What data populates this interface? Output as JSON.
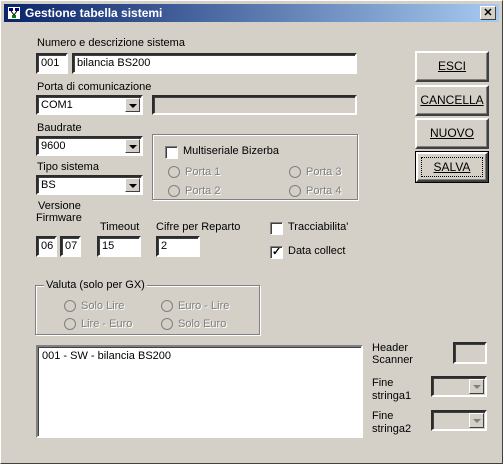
{
  "window": {
    "title": "Gestione tabella sistemi",
    "close_symbol": "✕"
  },
  "sistema": {
    "label": "Numero e descrizione sistema",
    "number": "001",
    "description": "bilancia BS200"
  },
  "porta": {
    "label": "Porta di comunicazione",
    "value": "COM1",
    "extra": ""
  },
  "baudrate": {
    "label": "Baudrate",
    "value": "9600"
  },
  "tipo": {
    "label": "Tipo sistema",
    "value": "BS"
  },
  "multiseriale": {
    "label": "Multiseriale Bizerba",
    "porta1": "Porta 1",
    "porta2": "Porta 2",
    "porta3": "Porta 3",
    "porta4": "Porta 4"
  },
  "versione": {
    "label_line1": "Versione",
    "label_line2": "Firmware",
    "major": "06",
    "minor": "07"
  },
  "timeout": {
    "label": "Timeout",
    "value": "15"
  },
  "cifre": {
    "label": "Cifre per Reparto",
    "value": "2"
  },
  "tracciabilita": {
    "label": "Tracciabilita'",
    "checked": false
  },
  "datacollect": {
    "label": "Data collect",
    "checked": true
  },
  "valuta": {
    "title": "Valuta (solo per GX)",
    "solo_lire": "Solo Lire",
    "euro_lire": "Euro - Lire",
    "lire_euro": "Lire - Euro",
    "solo_euro": "Solo Euro"
  },
  "list": {
    "items": [
      "001 - SW - bilancia BS200"
    ]
  },
  "scanner": {
    "header_label1": "Header",
    "header_label2": "Scanner",
    "header_value": "",
    "fine1_label1": "Fine",
    "fine1_label2": "stringa1",
    "fine1_value": "",
    "fine2_label1": "Fine",
    "fine2_label2": "stringa2",
    "fine2_value": ""
  },
  "buttons": {
    "esci": "ESCI",
    "cancella": "CANCELLA",
    "nuovo": "NUOVO",
    "salva": "SALVA"
  },
  "icons": {
    "app": "network-icon",
    "close": "close-icon"
  }
}
